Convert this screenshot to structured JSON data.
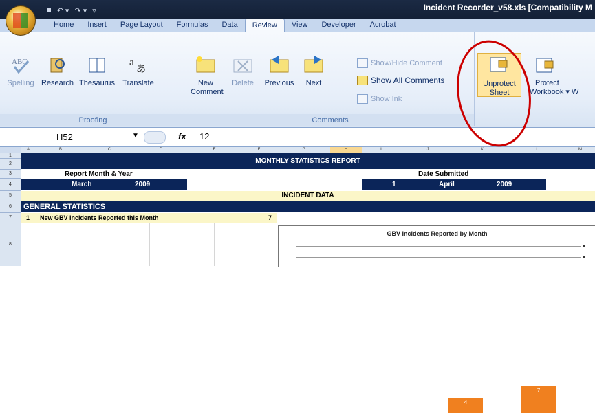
{
  "window": {
    "title": "Incident Recorder_v58.xls  [Compatibility M"
  },
  "qat": {
    "save": "■",
    "undo": "↶ ▾",
    "redo": "↷ ▾",
    "customize": "▿"
  },
  "tabs": [
    "Home",
    "Insert",
    "Page Layout",
    "Formulas",
    "Data",
    "Review",
    "View",
    "Developer",
    "Acrobat"
  ],
  "proofing": {
    "spelling": "Spelling",
    "research": "Research",
    "thesaurus": "Thesaurus",
    "translate": "Translate",
    "label": "Proofing"
  },
  "comments": {
    "new_l1": "New",
    "new_l2": "Comment",
    "delete": "Delete",
    "previous": "Previous",
    "next": "Next",
    "show_hide": "Show/Hide Comment",
    "show_all": "Show All Comments",
    "show_ink": "Show Ink",
    "label": "Comments"
  },
  "changes": {
    "unprotect_l1": "Unprotect",
    "unprotect_l2": "Sheet",
    "protect_l1": "Protect",
    "protect_l2": "Workbook ▾ W"
  },
  "formula": {
    "name_box": "H52",
    "fx": "fx",
    "value": "12"
  },
  "columns": [
    "A",
    "B",
    "C",
    "D",
    "E",
    "F",
    "G",
    "H",
    "I",
    "J",
    "K",
    "L",
    "M"
  ],
  "rows": [
    "1",
    "2",
    "3",
    "4",
    "5",
    "6",
    "7",
    "8"
  ],
  "sheet": {
    "report_title": "MONTHLY STATISTICS REPORT",
    "report_month_label": "Report Month & Year",
    "date_submitted_label": "Date Submitted",
    "month": "March",
    "year": "2009",
    "sub_day": "1",
    "sub_month": "April",
    "sub_year": "2009",
    "incident_data": "INCIDENT DATA",
    "general_stats": "GENERAL STATISTICS",
    "row7_num": "1",
    "row7_label": "New GBV Incidents Reported this Month",
    "row7_value": "7"
  },
  "chart_data": {
    "type": "bar",
    "title": "GBV Incidents Reported by Month",
    "data_labels": [
      "4",
      "7"
    ],
    "values": [
      4,
      7
    ],
    "bar_color": "#f0801f"
  },
  "colors": {
    "navy": "#0b2559",
    "cream": "#fbf6c8",
    "annotation": "#cc0000"
  }
}
